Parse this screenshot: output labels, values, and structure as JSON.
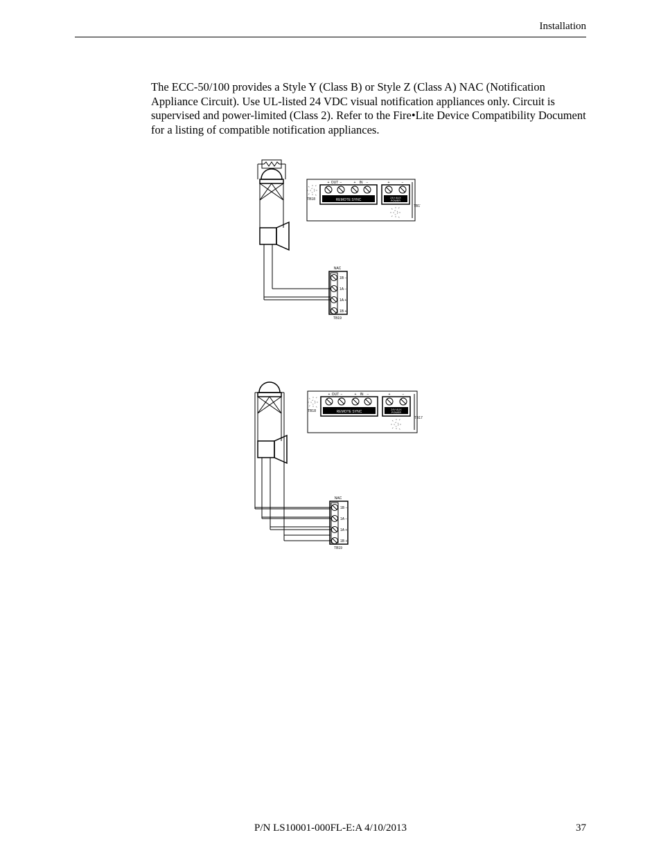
{
  "header": {
    "section": "Installation"
  },
  "body": {
    "paragraph": "The ECC-50/100 provides a Style Y (Class B) or Style Z (Class A) NAC (Notification Appliance Circuit). Use UL-listed 24 VDC visual notification appliances only. Circuit is supervised and power-limited (Class 2). Refer to the Fire•Lite Device Compatibility Document for a listing of compatible notification appliances."
  },
  "diagram_labels": {
    "tb18": "TB18",
    "tb17": "TB17",
    "tb19": "TB19",
    "remote_sync": "REMOTE SYNC",
    "aux_power": "24V AUX POWER",
    "nac": "NAC",
    "out_plus": "+",
    "out_label": "OUT",
    "out_minus": "−",
    "in_plus": "+",
    "in_label": "IN",
    "in_minus": "−",
    "aux_plus": "+",
    "aux_minus": "−",
    "nac_1b_minus": "1B −",
    "nac_1a_minus": "1A −",
    "nac_1a_plus": "1A +",
    "nac_1b_plus": "1B +"
  },
  "footer": {
    "doc_id": "P/N LS10001-000FL-E:A  4/10/2013",
    "page": "37"
  }
}
